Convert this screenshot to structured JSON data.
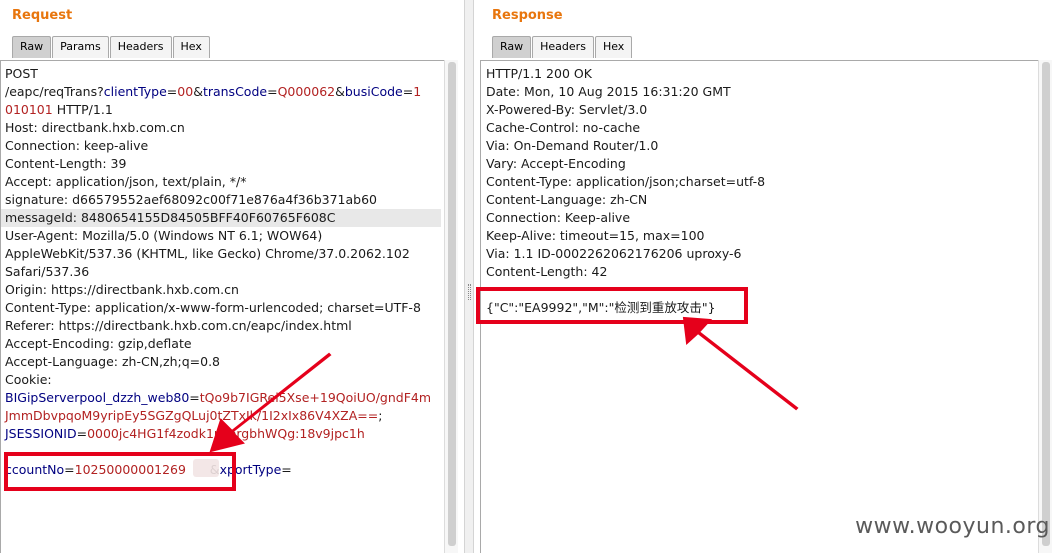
{
  "request": {
    "title": "Request",
    "tabs": [
      "Raw",
      "Params",
      "Headers",
      "Hex"
    ],
    "active_tab": "Raw",
    "lines": [
      [
        {
          "t": "POST",
          "c": "p"
        }
      ],
      [
        {
          "t": "/eapc/reqTrans?",
          "c": "p"
        },
        {
          "t": "clientType",
          "c": "k"
        },
        {
          "t": "=",
          "c": "p"
        },
        {
          "t": "00",
          "c": "v"
        },
        {
          "t": "&",
          "c": "p"
        },
        {
          "t": "transCode",
          "c": "k"
        },
        {
          "t": "=",
          "c": "p"
        },
        {
          "t": "Q000062",
          "c": "v"
        },
        {
          "t": "&",
          "c": "p"
        },
        {
          "t": "busiCode",
          "c": "k"
        },
        {
          "t": "=",
          "c": "p"
        },
        {
          "t": "1",
          "c": "v"
        }
      ],
      [
        {
          "t": "010101",
          "c": "v"
        },
        {
          "t": " HTTP/1.1",
          "c": "p"
        }
      ],
      [
        {
          "t": "Host: directbank.hxb.com.cn",
          "c": "p"
        }
      ],
      [
        {
          "t": "Connection: keep-alive",
          "c": "p"
        }
      ],
      [
        {
          "t": "Content-Length: 39",
          "c": "p"
        }
      ],
      [
        {
          "t": "Accept: application/json, text/plain, */*",
          "c": "p"
        }
      ],
      [
        {
          "t": "signature: d66579552aef68092c00f71e876a4f36b371ab60",
          "c": "p"
        }
      ],
      [
        {
          "t": "messageId: 8480654155D84505BFF40F60765F608C",
          "c": "p"
        }
      ],
      [
        {
          "t": "User-Agent: Mozilla/5.0 (Windows NT 6.1; WOW64)",
          "c": "p"
        }
      ],
      [
        {
          "t": "AppleWebKit/537.36 (KHTML, like Gecko) Chrome/37.0.2062.102",
          "c": "p"
        }
      ],
      [
        {
          "t": "Safari/537.36",
          "c": "p"
        }
      ],
      [
        {
          "t": "Origin: https://directbank.hxb.com.cn",
          "c": "p"
        }
      ],
      [
        {
          "t": "Content-Type: application/x-www-form-urlencoded; charset=UTF-8",
          "c": "p"
        }
      ],
      [
        {
          "t": "Referer: https://directbank.hxb.com.cn/eapc/index.html",
          "c": "p"
        }
      ],
      [
        {
          "t": "Accept-Encoding: gzip,deflate",
          "c": "p"
        }
      ],
      [
        {
          "t": "Accept-Language: zh-CN,zh;q=0.8",
          "c": "p"
        }
      ],
      [
        {
          "t": "Cookie:",
          "c": "p"
        }
      ],
      [
        {
          "t": "BIGipServerpool_dzzh_web80",
          "c": "k"
        },
        {
          "t": "=",
          "c": "p"
        },
        {
          "t": "tQo9b7IGRei5Xse+19QoiUO/gndF4m",
          "c": "v"
        }
      ],
      [
        {
          "t": "JmmDbvpqoM9yripEy5SGZgQLuj0tZTxIk/1I2xIx86V4XZA==",
          "c": "v"
        },
        {
          "t": ";",
          "c": "p"
        }
      ],
      [
        {
          "t": "JSESSIONID",
          "c": "k"
        },
        {
          "t": "=",
          "c": "p"
        },
        {
          "t": "0000jc4HG1f4zodk1nzprgbhWQg:18v9jpc1h",
          "c": "v"
        }
      ],
      [
        {
          "t": "",
          "c": "p"
        }
      ],
      [
        {
          "t": "ccountNo",
          "c": "k"
        },
        {
          "t": "=",
          "c": "p"
        },
        {
          "t": "10250000001269",
          "c": "v"
        },
        {
          "t": "      &",
          "c": "p"
        },
        {
          "t": "xportType",
          "c": "k"
        },
        {
          "t": "=",
          "c": "p"
        }
      ]
    ]
  },
  "response": {
    "title": "Response",
    "tabs": [
      "Raw",
      "Headers",
      "Hex"
    ],
    "active_tab": "Raw",
    "lines": [
      [
        {
          "t": "HTTP/1.1 200 OK",
          "c": "p"
        }
      ],
      [
        {
          "t": "Date: Mon, 10 Aug 2015 16:31:20 GMT",
          "c": "p"
        }
      ],
      [
        {
          "t": "X-Powered-By: Servlet/3.0",
          "c": "p"
        }
      ],
      [
        {
          "t": "Cache-Control: no-cache",
          "c": "p"
        }
      ],
      [
        {
          "t": "Via: On-Demand Router/1.0",
          "c": "p"
        }
      ],
      [
        {
          "t": "Vary: Accept-Encoding",
          "c": "p"
        }
      ],
      [
        {
          "t": "Content-Type: application/json;charset=utf-8",
          "c": "p"
        }
      ],
      [
        {
          "t": "Content-Language: zh-CN",
          "c": "p"
        }
      ],
      [
        {
          "t": "Connection: Keep-alive",
          "c": "p"
        }
      ],
      [
        {
          "t": "Keep-Alive: timeout=15, max=100",
          "c": "p"
        }
      ],
      [
        {
          "t": "Via: 1.1 ID-0002262062176206 uproxy-6",
          "c": "p"
        }
      ],
      [
        {
          "t": "Content-Length: 42",
          "c": "p"
        }
      ],
      [
        {
          "t": "",
          "c": "p"
        }
      ],
      [
        {
          "t": "{\"C\":\"EA9992\",\"M\":\"检测到重放攻击\"}",
          "c": "p"
        }
      ]
    ]
  },
  "watermark": "www.wooyun.org",
  "colors": {
    "title_orange": "#e8760e",
    "key_blue": "#000080",
    "value_red": "#b22222",
    "annotation_red": "#e5001b"
  }
}
